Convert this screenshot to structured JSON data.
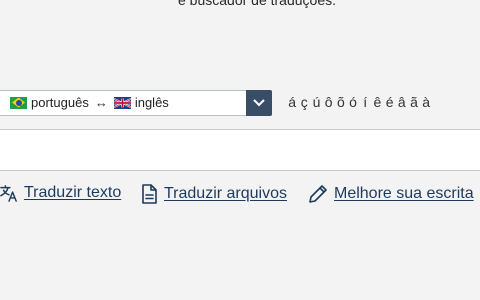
{
  "header": {
    "tagline": "e buscador de traduções."
  },
  "language_selector": {
    "source_language": "português",
    "target_language": "inglês",
    "source_flag": "brazil-flag-icon",
    "target_flag": "uk-flag-icon",
    "swap_symbol": "↔"
  },
  "accent_keys": [
    "á",
    "ç",
    "ú",
    "ô",
    "õ",
    "ó",
    "í",
    "ê",
    "é",
    "â",
    "ã",
    "à"
  ],
  "search": {
    "value": "",
    "placeholder": ""
  },
  "links": [
    {
      "label": "Traduzir texto",
      "icon": "translate-icon"
    },
    {
      "label": "Traduzir arquivos",
      "icon": "document-icon"
    },
    {
      "label": "Melhore sua escrita",
      "icon": "pencil-icon"
    }
  ],
  "colors": {
    "background": "#f3f3f3",
    "accent": "#3a4d66",
    "link": "#1d3a5c"
  }
}
